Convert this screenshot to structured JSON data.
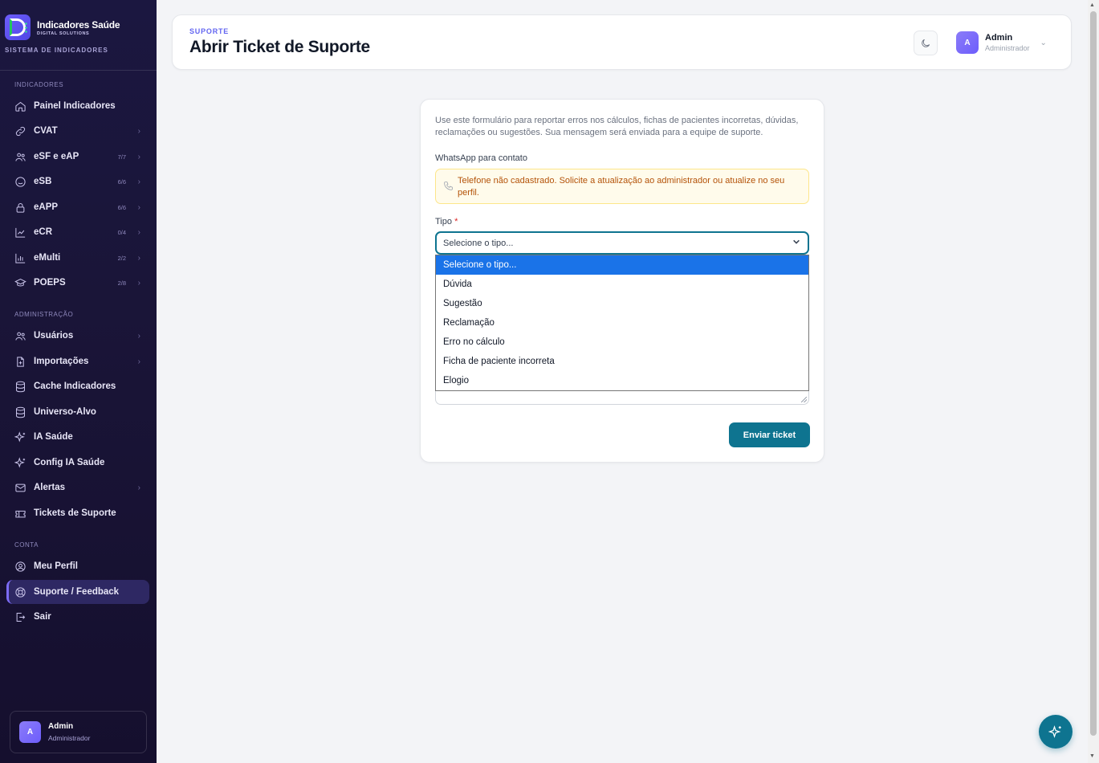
{
  "brand": {
    "name": "Indicadores Saúde",
    "sub": "DIGITAL SOLUTIONS",
    "system": "SISTEMA DE INDICADORES"
  },
  "sidebar": {
    "sections": [
      "INDICADORES",
      "ADMINISTRAÇÃO",
      "CONTA"
    ],
    "items": [
      {
        "label": "Painel Indicadores",
        "icon": "home-icon",
        "badge": "",
        "chevron": false
      },
      {
        "label": "CVAT",
        "icon": "link-icon",
        "badge": "",
        "chevron": true
      },
      {
        "label": "eSF e eAP",
        "icon": "users-icon",
        "badge": "7/7",
        "chevron": true
      },
      {
        "label": "eSB",
        "icon": "smile-icon",
        "badge": "6/6",
        "chevron": true
      },
      {
        "label": "eAPP",
        "icon": "lock-icon",
        "badge": "6/6",
        "chevron": true
      },
      {
        "label": "eCR",
        "icon": "chart-icon",
        "badge": "0/4",
        "chevron": true
      },
      {
        "label": "eMulti",
        "icon": "bar-chart-icon",
        "badge": "2/2",
        "chevron": true
      },
      {
        "label": "POEPS",
        "icon": "graduation-icon",
        "badge": "2/8",
        "chevron": true
      },
      {
        "label": "Usuários",
        "icon": "users-icon",
        "badge": "",
        "chevron": true
      },
      {
        "label": "Importações",
        "icon": "file-import-icon",
        "badge": "",
        "chevron": true
      },
      {
        "label": "Cache Indicadores",
        "icon": "database-icon",
        "badge": "",
        "chevron": false
      },
      {
        "label": "Universo-Alvo",
        "icon": "database-icon",
        "badge": "",
        "chevron": false
      },
      {
        "label": "IA Saúde",
        "icon": "sparkles-icon",
        "badge": "",
        "chevron": false
      },
      {
        "label": "Config IA Saúde",
        "icon": "sparkles-icon",
        "badge": "",
        "chevron": false
      },
      {
        "label": "Alertas",
        "icon": "mail-icon",
        "badge": "",
        "chevron": true
      },
      {
        "label": "Tickets de Suporte",
        "icon": "ticket-icon",
        "badge": "",
        "chevron": false
      },
      {
        "label": "Meu Perfil",
        "icon": "user-circle-icon",
        "badge": "",
        "chevron": false
      },
      {
        "label": "Suporte / Feedback",
        "icon": "lifebuoy-icon",
        "badge": "",
        "chevron": false,
        "active": true
      },
      {
        "label": "Sair",
        "icon": "logout-icon",
        "badge": "",
        "chevron": false
      }
    ],
    "user": {
      "initial": "A",
      "name": "Admin",
      "role": "Administrador"
    }
  },
  "header": {
    "crumb": "SUPORTE",
    "title": "Abrir Ticket de Suporte",
    "user": {
      "initial": "A",
      "name": "Admin",
      "role": "Administrador"
    }
  },
  "form": {
    "intro": "Use este formulário para reportar erros nos cálculos, fichas de pacientes incorretas, dúvidas, reclamações ou sugestões. Sua mensagem será enviada para a equipe de suporte.",
    "whatsapp_label": "WhatsApp para contato",
    "phone_warning": "Telefone não cadastrado. Solicite a atualização ao administrador ou atualize no seu perfil.",
    "tipo_label": "Tipo",
    "required_mark": "*",
    "tipo_value": "Selecione o tipo...",
    "tipo_options": [
      "Selecione o tipo...",
      "Dúvida",
      "Sugestão",
      "Reclamação",
      "Erro no cálculo",
      "Ficha de paciente incorreta",
      "Elogio"
    ],
    "submit_label": "Enviar ticket"
  },
  "colors": {
    "accent": "#0e7490",
    "brand": "#6d5dfc",
    "sidebar_bg": "#1b1740",
    "warning_bg": "#fffbeb",
    "warning_text": "#b45309",
    "option_highlight": "#1a73e8"
  }
}
